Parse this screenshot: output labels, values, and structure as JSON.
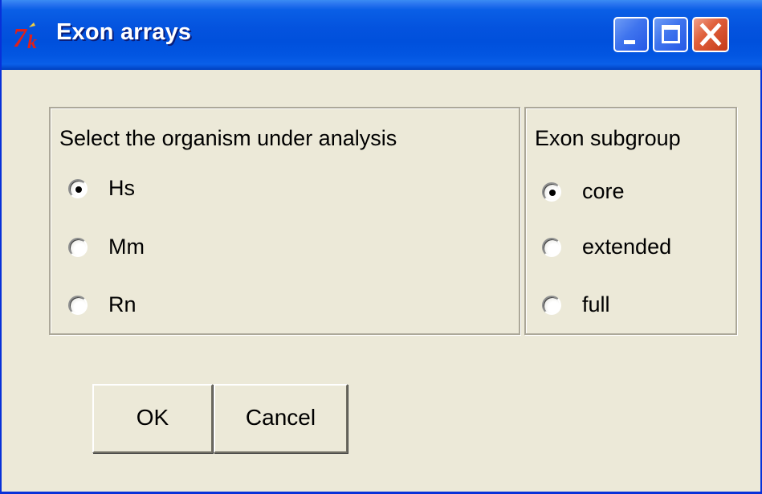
{
  "window": {
    "title": "Exon arrays",
    "controls": {
      "minimize_icon": "minimize-icon",
      "maximize_icon": "maximize-icon",
      "close_icon": "close-icon"
    }
  },
  "organism_group": {
    "title": "Select the organism under analysis",
    "options": [
      {
        "label": "Hs",
        "selected": true
      },
      {
        "label": "Mm",
        "selected": false
      },
      {
        "label": "Rn",
        "selected": false
      }
    ]
  },
  "exon_group": {
    "title": "Exon subgroup",
    "options": [
      {
        "label": "core",
        "selected": true
      },
      {
        "label": "extended",
        "selected": false
      },
      {
        "label": "full",
        "selected": false
      }
    ]
  },
  "buttons": {
    "ok_label": "OK",
    "cancel_label": "Cancel"
  },
  "colors": {
    "titlebar": "#0453de",
    "window_bg": "#ece9d8",
    "close_button": "#c53a18"
  }
}
